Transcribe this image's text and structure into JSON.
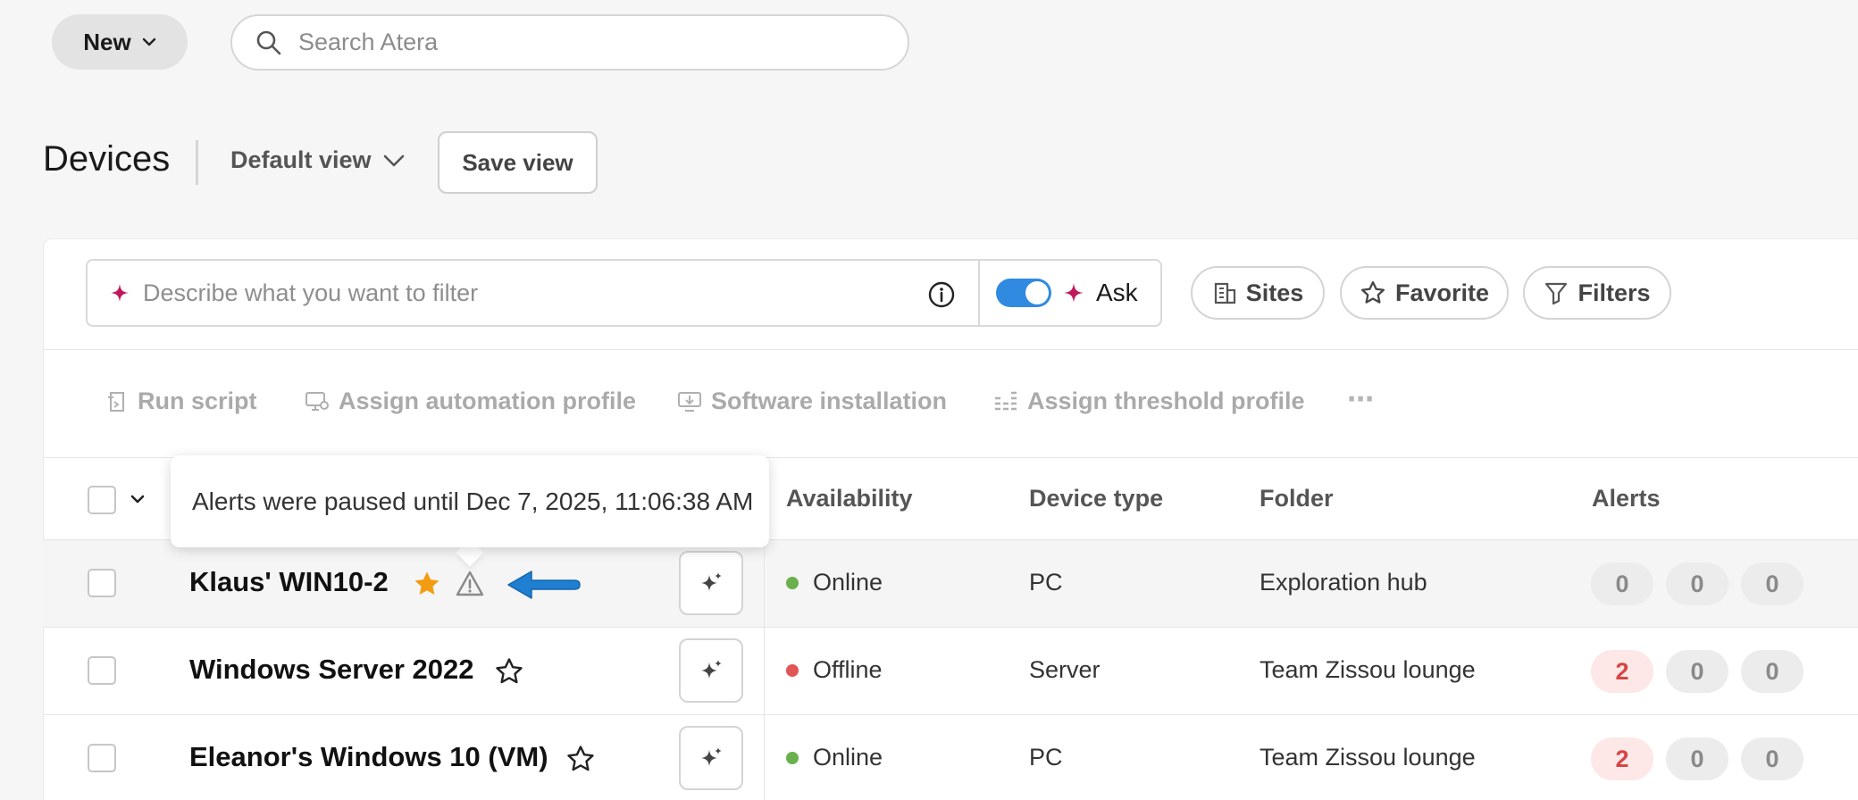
{
  "top": {
    "new_label": "New",
    "search_placeholder": "Search Atera"
  },
  "header": {
    "title": "Devices",
    "view": "Default view",
    "save_view": "Save view"
  },
  "filter": {
    "placeholder": "Describe what you want to filter",
    "ask_label": "Ask",
    "toggle_on": true,
    "chips": [
      "Sites",
      "Favorite",
      "Filters"
    ]
  },
  "actions": {
    "run_script": "Run script",
    "assign_automation": "Assign automation profile",
    "software_installation": "Software installation",
    "assign_threshold": "Assign threshold profile",
    "more": "⋯"
  },
  "table": {
    "headers": {
      "availability": "Availability",
      "device_type": "Device type",
      "folder": "Folder",
      "alerts": "Alerts"
    },
    "rows": [
      {
        "name": "Klaus' WIN10-2",
        "favorite": true,
        "alerts_paused": true,
        "availability": "Online",
        "device_type": "PC",
        "folder": "Exploration hub",
        "alerts": [
          "0",
          "0",
          "0"
        ]
      },
      {
        "name": "Windows Server 2022",
        "favorite": false,
        "alerts_paused": false,
        "availability": "Offline",
        "device_type": "Server",
        "folder": "Team Zissou lounge",
        "alerts": [
          "2",
          "0",
          "0"
        ]
      },
      {
        "name": "Eleanor's Windows 10 (VM)",
        "favorite": false,
        "alerts_paused": false,
        "availability": "Online",
        "device_type": "PC",
        "folder": "Team Zissou lounge",
        "alerts": [
          "2",
          "0",
          "0"
        ]
      }
    ]
  },
  "tooltip": {
    "text": "Alerts were paused until Dec 7, 2025, 11:06:38 AM"
  },
  "colors": {
    "online": "#6ab04c",
    "offline": "#e25555",
    "favorite": "#f39c12",
    "accent": "#2f8ae0",
    "sparkle": "#c2185b",
    "arrow": "#1f7fd1"
  }
}
